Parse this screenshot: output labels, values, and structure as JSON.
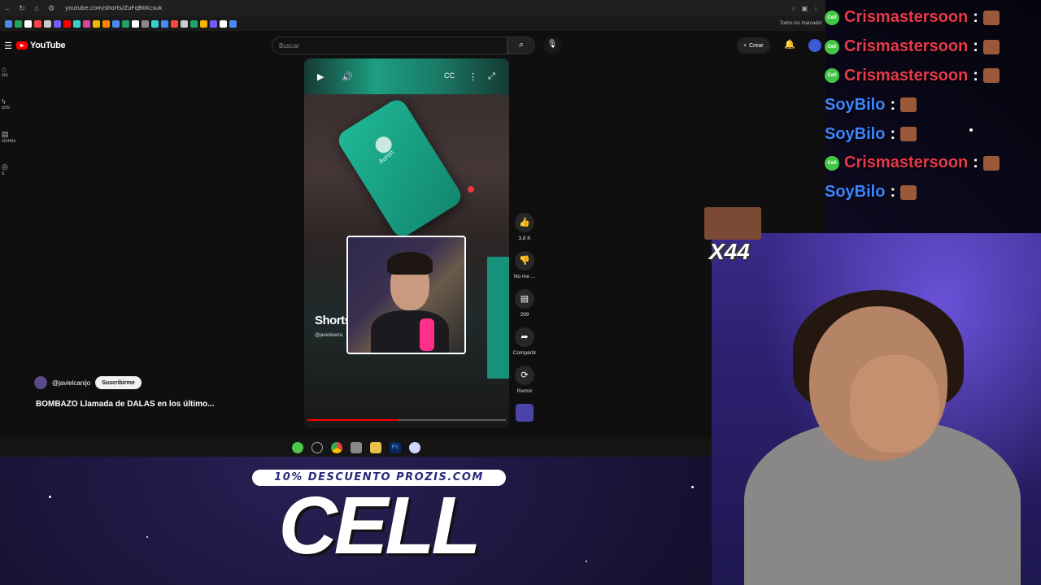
{
  "browser": {
    "url": "youtube.com/shorts/ZuFqBkKcsuk",
    "bookmarks_label": "Todos los marcador"
  },
  "youtube": {
    "logo_text": "YouTube",
    "search_placeholder": "Buscar",
    "create_label": "Crear",
    "mini_nav": [
      "cio",
      "orts",
      "ciones",
      "ú"
    ]
  },
  "video": {
    "phone_name": "Auron",
    "shorts_label": "Shorts",
    "shorts_handle": "@javioliveira",
    "progress": 0.46
  },
  "actions": {
    "likes": "3,8 K",
    "dislike": "No me ...",
    "comments": "299",
    "share": "Compartir",
    "remix": "Remix"
  },
  "channel": {
    "handle": "@javielcanijo",
    "subscribe": "Suscribirme",
    "title": "BOMBAZO  Llamada de DALAS en los último..."
  },
  "chat": {
    "messages": [
      {
        "user": "Crismastersoon",
        "color": "#e8394a"
      },
      {
        "user": "Crismastersoon",
        "color": "#e8394a"
      },
      {
        "user": "Crismastersoon",
        "color": "#e8394a"
      },
      {
        "user": "SoyBilo",
        "color": "#3b86ff"
      },
      {
        "user": "SoyBilo",
        "color": "#3b86ff"
      },
      {
        "user": "Crismastersoon",
        "color": "#e8394a"
      },
      {
        "user": "SoyBilo",
        "color": "#3b86ff"
      }
    ],
    "multiplier": "X44"
  },
  "overlay": {
    "promo": "10% DESCUENTO PROZIS.COM",
    "code": "CELL"
  }
}
